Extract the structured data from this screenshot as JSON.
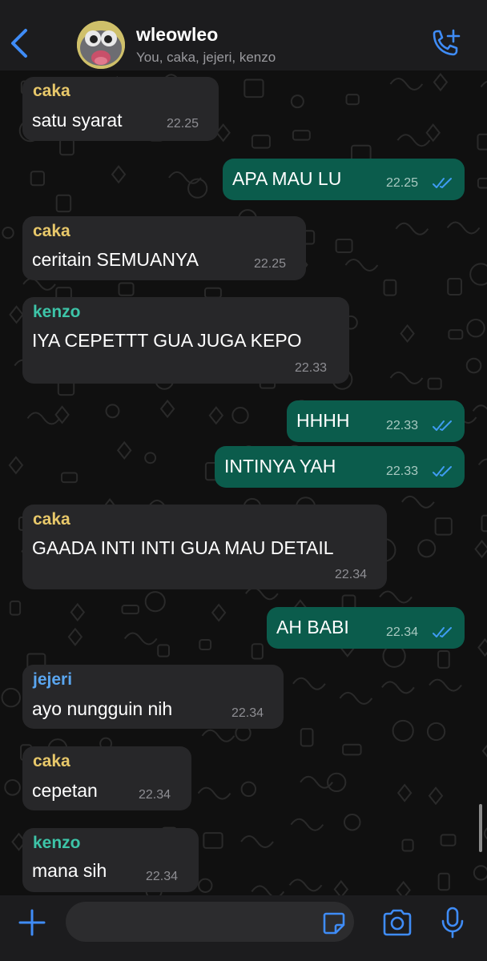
{
  "header": {
    "title": "wleowleo",
    "subtitle": "You, caka, jejeri, kenzo"
  },
  "colors": {
    "caka": "#e8c86a",
    "kenzo": "#3dc4a8",
    "jejeri": "#5aa6f0",
    "outgoing_bubble": "#0b5c4c",
    "incoming_bubble": "#272729",
    "accent": "#3f8cf7"
  },
  "messages": [
    {
      "sender": "caka",
      "text": "satu syarat",
      "time": "22.25"
    },
    {
      "sender": "",
      "text": "APA MAU LU",
      "time": "22.25",
      "status": "read"
    },
    {
      "sender": "caka",
      "text": "ceritain SEMUANYA",
      "time": "22.25"
    },
    {
      "sender": "kenzo",
      "text": "IYA CEPETTT GUA JUGA KEPO",
      "time": "22.33"
    },
    {
      "sender": "",
      "text": "HHHH",
      "time": "22.33",
      "status": "read"
    },
    {
      "sender": "",
      "text": "INTINYA YAH",
      "time": "22.33",
      "status": "read"
    },
    {
      "sender": "caka",
      "text": "GAADA INTI INTI GUA MAU DETAIL",
      "time": "22.34"
    },
    {
      "sender": "",
      "text": "AH BABI",
      "time": "22.34",
      "status": "read"
    },
    {
      "sender": "jejeri",
      "text": "ayo nungguin nih",
      "time": "22.34"
    },
    {
      "sender": "caka",
      "text": "cepetan",
      "time": "22.34"
    },
    {
      "sender": "kenzo",
      "text": "mana sih",
      "time": "22.34"
    }
  ],
  "icons": {
    "back": "chevron-left-icon",
    "call": "add-call-icon",
    "attach": "plus-icon",
    "sticker": "sticker-icon",
    "camera": "camera-icon",
    "mic": "microphone-icon",
    "read_receipt": "double-check-icon"
  },
  "input": {
    "placeholder": ""
  }
}
